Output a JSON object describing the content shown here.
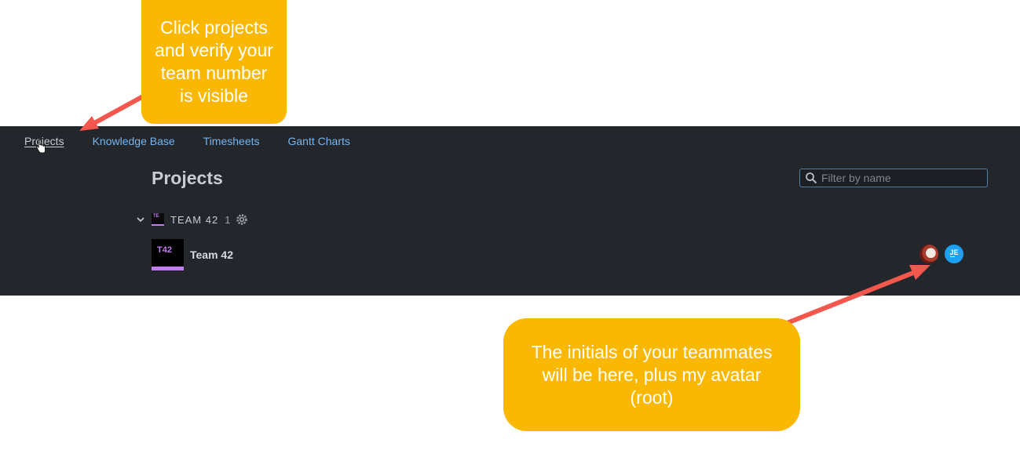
{
  "nav": {
    "items": [
      {
        "label": "Projects",
        "active": true
      },
      {
        "label": "Knowledge Base",
        "active": false
      },
      {
        "label": "Timesheets",
        "active": false
      },
      {
        "label": "Gantt Charts",
        "active": false
      }
    ]
  },
  "main": {
    "title": "Projects",
    "filter_placeholder": "Filter by name"
  },
  "group": {
    "avatar_initials": "TE",
    "name": "TEAM 42",
    "count": "1"
  },
  "project": {
    "avatar_initials": "T42",
    "name": "Team 42",
    "accent_color": "#c07ef0"
  },
  "members": [
    {
      "kind": "photo",
      "initials": ""
    },
    {
      "kind": "initials",
      "initials": "JE",
      "color": "#1da1f2"
    }
  ],
  "callouts": {
    "top": "Click projects\nand verify your\nteam number\nis visible",
    "bottom": "The initials of your teammates\nwill be here, plus my avatar\n(root)"
  },
  "colors": {
    "app_background": "#23262b",
    "callout": "#fbb802",
    "arrow": "#f4574e",
    "link": "#74b6f0"
  },
  "icons": [
    "search-icon",
    "chevron-down-icon",
    "gear-icon",
    "hand-cursor-icon"
  ]
}
